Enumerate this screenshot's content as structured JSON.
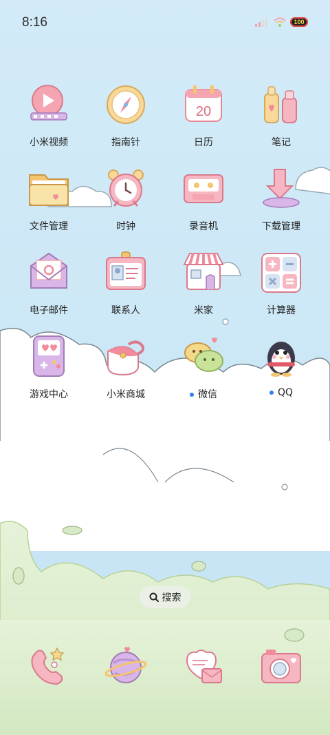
{
  "status_bar": {
    "time": "8:16",
    "battery": "100"
  },
  "apps": [
    {
      "label": "小米视频",
      "icon": "video-icon"
    },
    {
      "label": "指南针",
      "icon": "compass-icon"
    },
    {
      "label": "日历",
      "icon": "calendar-icon",
      "calendar_day": "20"
    },
    {
      "label": "笔记",
      "icon": "notes-icon"
    },
    {
      "label": "文件管理",
      "icon": "folder-icon"
    },
    {
      "label": "时钟",
      "icon": "alarm-clock-icon"
    },
    {
      "label": "录音机",
      "icon": "cassette-icon"
    },
    {
      "label": "下载管理",
      "icon": "download-icon"
    },
    {
      "label": "电子邮件",
      "icon": "envelope-icon"
    },
    {
      "label": "联系人",
      "icon": "id-card-icon"
    },
    {
      "label": "米家",
      "icon": "house-icon"
    },
    {
      "label": "计算器",
      "icon": "calculator-icon"
    },
    {
      "label": "游戏中心",
      "icon": "game-console-icon"
    },
    {
      "label": "小米商城",
      "icon": "shopping-bag-icon"
    },
    {
      "label": "微信",
      "icon": "wechat-icon",
      "new_dot": true
    },
    {
      "label": "QQ",
      "icon": "penguin-icon",
      "new_dot": true
    }
  ],
  "search": {
    "label": "搜索"
  },
  "dock": [
    {
      "icon": "phone-icon"
    },
    {
      "icon": "planet-browser-icon"
    },
    {
      "icon": "heart-message-icon"
    },
    {
      "icon": "camera-icon"
    }
  ],
  "colors": {
    "sky": "#cfe8f7",
    "cloud": "#ffffff",
    "bush": "#dbecc4",
    "accent": "#ef8fa0",
    "dot": "#2f7df6"
  }
}
